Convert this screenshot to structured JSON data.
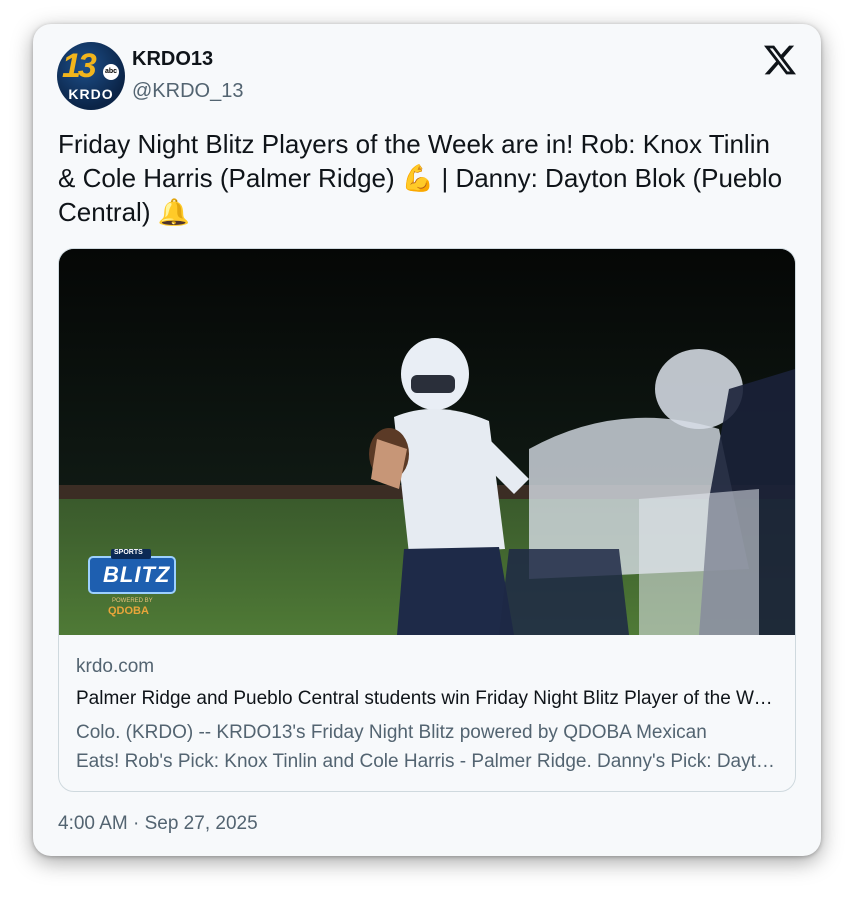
{
  "account": {
    "name": "KRDO13",
    "handle": "@KRDO_13",
    "avatar": {
      "number": "13",
      "network": "abc",
      "callsign": "KRDO"
    }
  },
  "platform_icon": "x-logo-icon",
  "tweet": {
    "text": "Friday Night Blitz Players of the Week are in! Rob: Knox Tinlin & Cole Harris (Palmer Ridge) 💪 | Danny: Dayton Blok (Pueblo Central) 🔔"
  },
  "link_card": {
    "image": {
      "subject": "football-quarterback-passing-photo",
      "logo": {
        "top": "SPORTS",
        "main": "BLITZ",
        "sponsor_line": "POWERED BY",
        "sponsor": "QDOBA"
      }
    },
    "domain": "krdo.com",
    "title": "Palmer Ridge and Pueblo Central students win Friday Night Blitz Player of the Week",
    "description_line1": "Colo. (KRDO) -- KRDO13's Friday Night Blitz powered by QDOBA Mexican",
    "description_line2": "Eats! Rob's Pick: Knox Tinlin and Cole Harris - Palmer Ridge. Danny's Pick: Dayton Blok - Pueblo Central."
  },
  "timestamp": "4:00 AM · Sep 27, 2025",
  "colors": {
    "text_primary": "#0f1419",
    "text_secondary": "#536471",
    "card_bg": "#f7f9fb",
    "border": "#cfd9de",
    "brand_gold": "#f2b51c",
    "brand_navy": "#0b2447"
  }
}
